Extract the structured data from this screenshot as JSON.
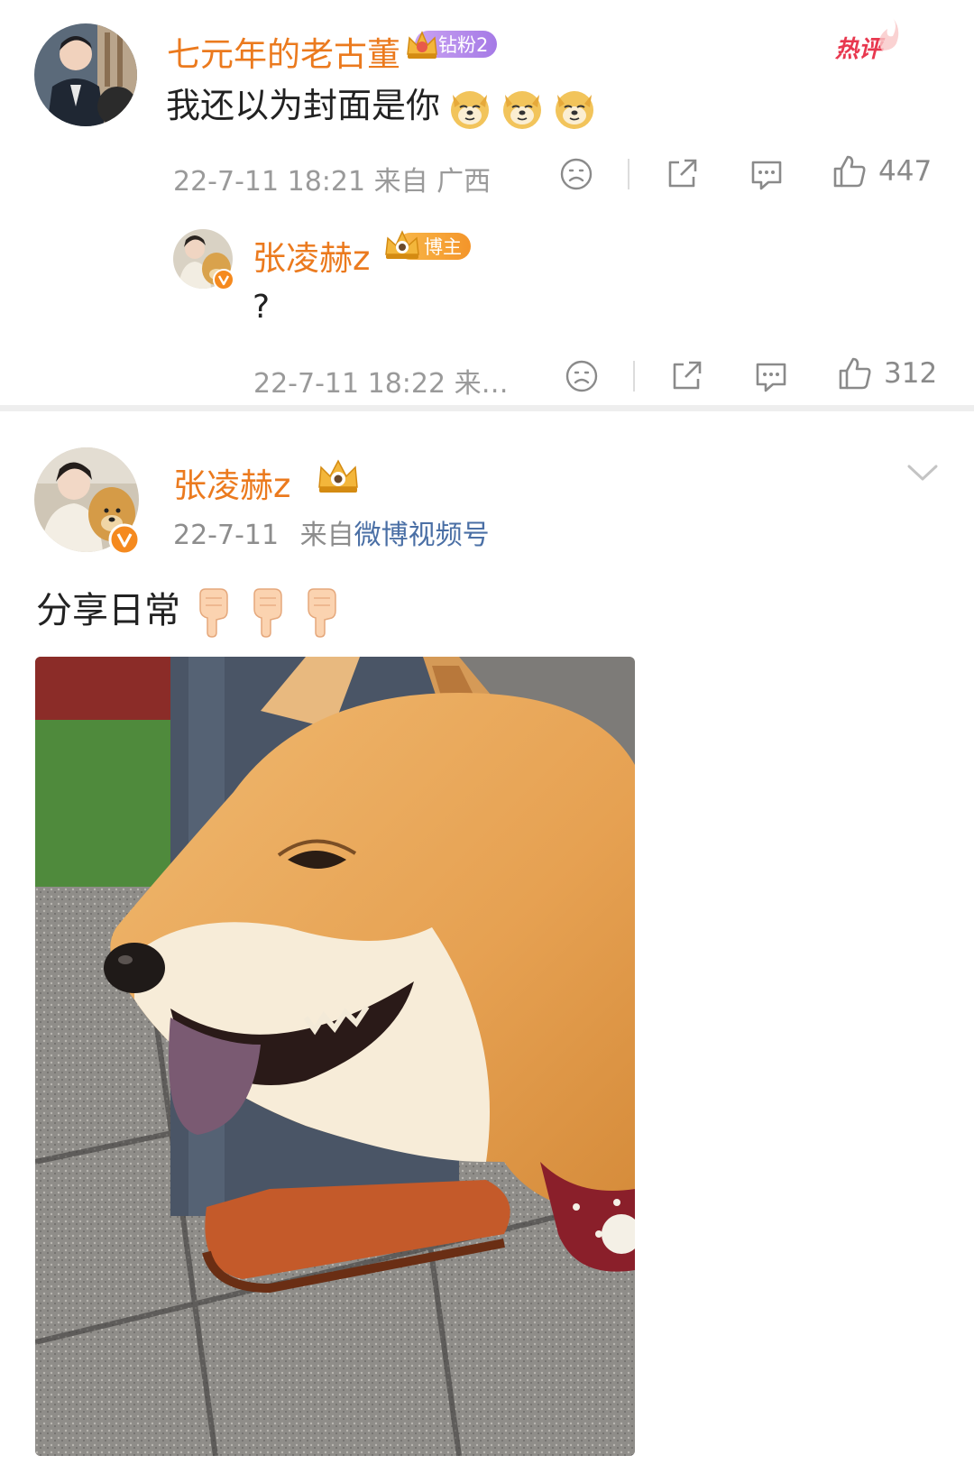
{
  "comment": {
    "username": "七元年的老古董",
    "fan_badge": "钻粉2",
    "hot_tag": "热评",
    "text": "我还以为封面是你",
    "emoji_name": "doge-emoji",
    "emoji_count": 3,
    "meta": "22-7-11 18:21 来自 广西",
    "likes": "447"
  },
  "reply": {
    "username": "张凌赫z",
    "role_badge": "博主",
    "text": "?",
    "meta": "22-7-11 18:22 来…",
    "likes": "312"
  },
  "post": {
    "username": "张凌赫z",
    "date": "22-7-11",
    "source_prefix": "来自",
    "source_link": "微博视频号",
    "text": "分享日常",
    "emoji_name": "pointing-down-emoji",
    "emoji_count": 3,
    "image_subject": "shiba-inu-photo"
  },
  "colors": {
    "username": "#eb7a1e",
    "link": "#4a6fa5",
    "meta": "#9a9a9a",
    "hot_tag": "#e8384f",
    "badge_purple": "#b58cf0",
    "badge_orange": "#f6a637"
  }
}
